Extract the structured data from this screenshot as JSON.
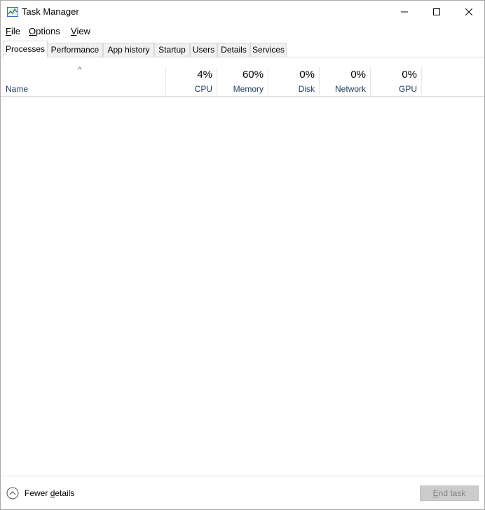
{
  "window": {
    "title": "Task Manager",
    "icon": "task-manager-icon",
    "controls": {
      "minimize": "minimize-icon",
      "maximize": "maximize-icon",
      "close": "close-icon"
    }
  },
  "menu": {
    "file": {
      "accel": "F",
      "rest": "ile"
    },
    "options": {
      "accel": "O",
      "rest": "ptions"
    },
    "view": {
      "accel": "V",
      "rest": "iew"
    }
  },
  "tabs": [
    "Processes",
    "Performance",
    "App history",
    "Startup",
    "Users",
    "Details",
    "Services"
  ],
  "active_tab": "Processes",
  "columns": {
    "sort_indicator": "^",
    "name": "Name",
    "cpu": {
      "percent": "4%",
      "label": "CPU"
    },
    "memory": {
      "percent": "60%",
      "label": "Memory"
    },
    "disk": {
      "percent": "0%",
      "label": "Disk"
    },
    "network": {
      "percent": "0%",
      "label": "Network"
    },
    "gpu": {
      "percent": "0%",
      "label": "GPU"
    }
  },
  "footer": {
    "fewer_details": {
      "pre": "Fewer ",
      "accel": "d",
      "post": "etails"
    },
    "end_task": {
      "accel": "E",
      "rest": "nd task"
    },
    "end_task_enabled": false
  },
  "colors": {
    "header_label": "#1e395b",
    "disabled_button_bg": "#cccccc",
    "disabled_button_text": "#838383"
  }
}
